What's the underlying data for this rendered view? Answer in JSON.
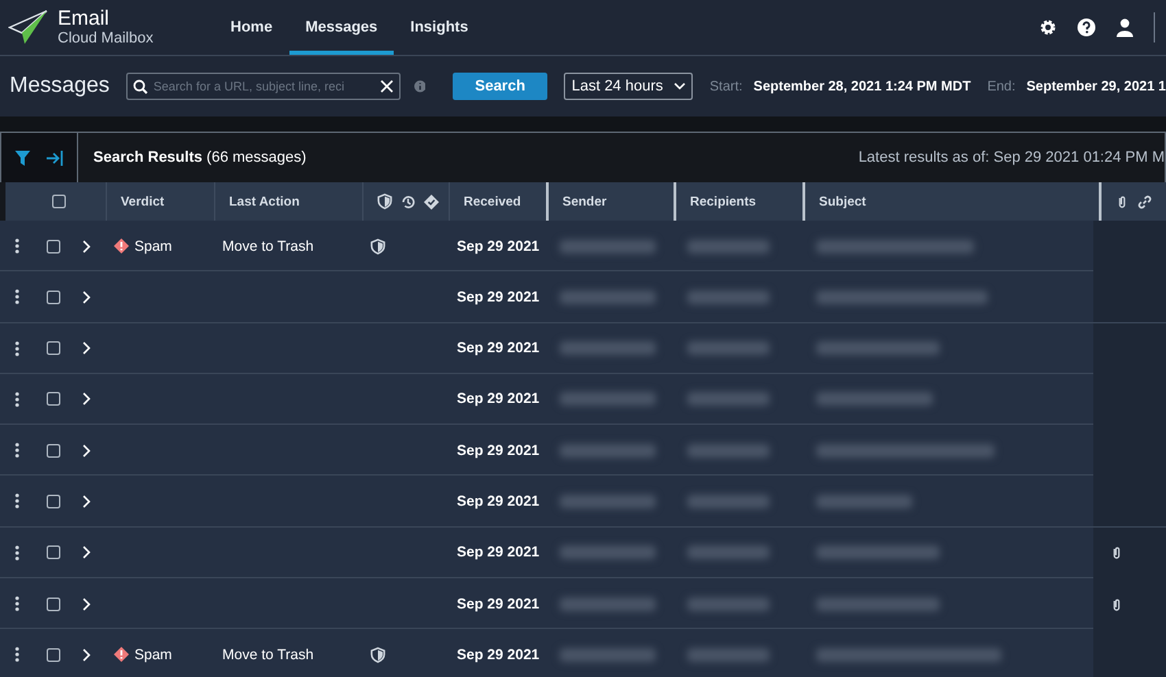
{
  "app": {
    "title": "Email",
    "subtitle": "Cloud Mailbox"
  },
  "nav": [
    {
      "label": "Home",
      "selected": false
    },
    {
      "label": "Messages",
      "selected": true
    },
    {
      "label": "Insights",
      "selected": false
    }
  ],
  "toolbar": {
    "title": "Messages",
    "search": {
      "placeholder": "Search for a URL, subject line, reci"
    },
    "search_button": "Search",
    "range": "Last 24 hours",
    "start_label": "Start:",
    "start": "September 28, 2021 1:24 PM MDT",
    "end_label": "End:",
    "end": "September 29, 2021 1"
  },
  "results": {
    "title": "Search Results",
    "count": "(66 messages)",
    "latest": "Latest results as of: Sep 29 2021 01:24 PM M"
  },
  "table": {
    "select_all_checked": false,
    "columns": [
      "Verdict",
      "Last Action",
      "Received",
      "Sender",
      "Recipients",
      "Subject"
    ],
    "rows": [
      {
        "verdict": "Spam",
        "last_action": "Move to Trash",
        "shield": true,
        "received": "Sep 29 2021",
        "attachment": false,
        "checked": false
      },
      {
        "received": "Sep 29 2021",
        "shield": false,
        "attachment": false,
        "checked": false
      },
      {
        "received": "Sep 29 2021",
        "shield": false,
        "attachment": false,
        "checked": false
      },
      {
        "received": "Sep 29 2021",
        "shield": false,
        "attachment": false,
        "checked": false
      },
      {
        "received": "Sep 29 2021",
        "shield": false,
        "attachment": false,
        "checked": false
      },
      {
        "received": "Sep 29 2021",
        "shield": false,
        "attachment": false,
        "checked": false
      },
      {
        "received": "Sep 29 2021",
        "shield": false,
        "attachment": true,
        "checked": false
      },
      {
        "received": "Sep 29 2021",
        "shield": false,
        "attachment": true,
        "checked": false
      },
      {
        "verdict": "Spam",
        "last_action": "Move to Trash",
        "shield": true,
        "received": "Sep 29 2021",
        "attachment": false,
        "checked": false
      }
    ]
  }
}
